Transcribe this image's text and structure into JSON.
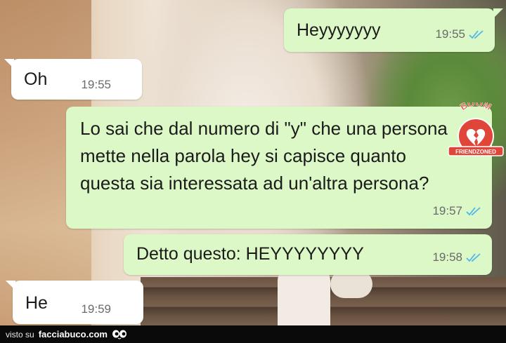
{
  "messages": [
    {
      "id": "m1",
      "direction": "outgoing",
      "text": "Heyyyyyyy",
      "time": "19:55",
      "status": "read"
    },
    {
      "id": "m2",
      "direction": "incoming",
      "text": "Oh",
      "time": "19:55"
    },
    {
      "id": "m3",
      "direction": "outgoing",
      "text": "Lo sai che dal numero di \"y\" che una persona mette nella parola hey si capisce quanto questa sia interessata ad un'altra persona?",
      "time": "19:57",
      "status": "read"
    },
    {
      "id": "m4",
      "direction": "outgoing",
      "text": "Detto questo: HEYYYYYYYY",
      "time": "19:58",
      "status": "read"
    },
    {
      "id": "m5",
      "direction": "incoming",
      "text": "He",
      "time": "19:59"
    }
  ],
  "stamp": {
    "top_text": "BOOM",
    "banner_text": "FRIENDZONED",
    "icon": "broken-heart-icon"
  },
  "footer": {
    "prefix": "visto su",
    "site": "facciabuco.com",
    "icon": "eyes-icon"
  },
  "colors": {
    "outgoing_bubble": "#dcf8c6",
    "incoming_bubble": "#ffffff",
    "read_ticks": "#4fb6ec",
    "stamp_red": "#e0453a"
  }
}
